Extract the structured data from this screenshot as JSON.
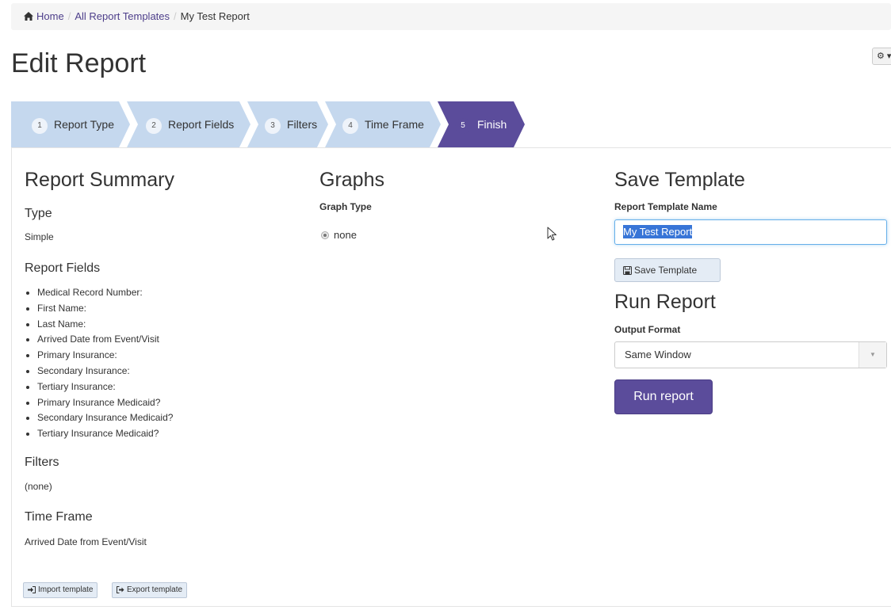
{
  "breadcrumb": {
    "items": [
      "Home",
      "All Report Templates"
    ],
    "current": "My Test Report"
  },
  "header": {
    "title": "Edit Report",
    "gear_label": "⚙ ▾"
  },
  "wizard": {
    "steps": [
      {
        "number": "1",
        "label": "Report Type"
      },
      {
        "number": "2",
        "label": "Report Fields"
      },
      {
        "number": "3",
        "label": "Filters"
      },
      {
        "number": "4",
        "label": "Time Frame"
      },
      {
        "number": "5",
        "label": "Finish"
      }
    ],
    "active_step": "5"
  },
  "summary": {
    "title": "Report Summary",
    "type_heading": "Type",
    "type_value": "Simple",
    "fields_heading": "Report Fields",
    "fields": [
      "Medical Record Number:",
      "First Name:",
      "Last Name:",
      "Arrived Date from Event/Visit",
      "Primary Insurance:",
      "Secondary Insurance:",
      "Tertiary Insurance:",
      "Primary Insurance Medicaid?",
      "Secondary Insurance Medicaid?",
      "Tertiary Insurance Medicaid?"
    ],
    "filters_heading": "Filters",
    "filters_value": "(none)",
    "timeframe_heading": "Time Frame",
    "timeframe_value": "Arrived Date from Event/Visit"
  },
  "graphs": {
    "title": "Graphs",
    "graph_type_label": "Graph Type",
    "option": "none"
  },
  "save_template": {
    "title": "Save Template",
    "name_label": "Report Template Name",
    "name_value": "My Test Report",
    "save_button": "Save Template"
  },
  "run_report": {
    "title": "Run Report",
    "output_label": "Output Format",
    "output_value": "Same Window",
    "run_button": "Run report"
  },
  "footer": {
    "import_button": "Import template",
    "export_button": "Export template"
  },
  "colors": {
    "accent": "#5b4c9b",
    "step_inactive": "#c5d8ee",
    "link": "#4d3e8a"
  }
}
